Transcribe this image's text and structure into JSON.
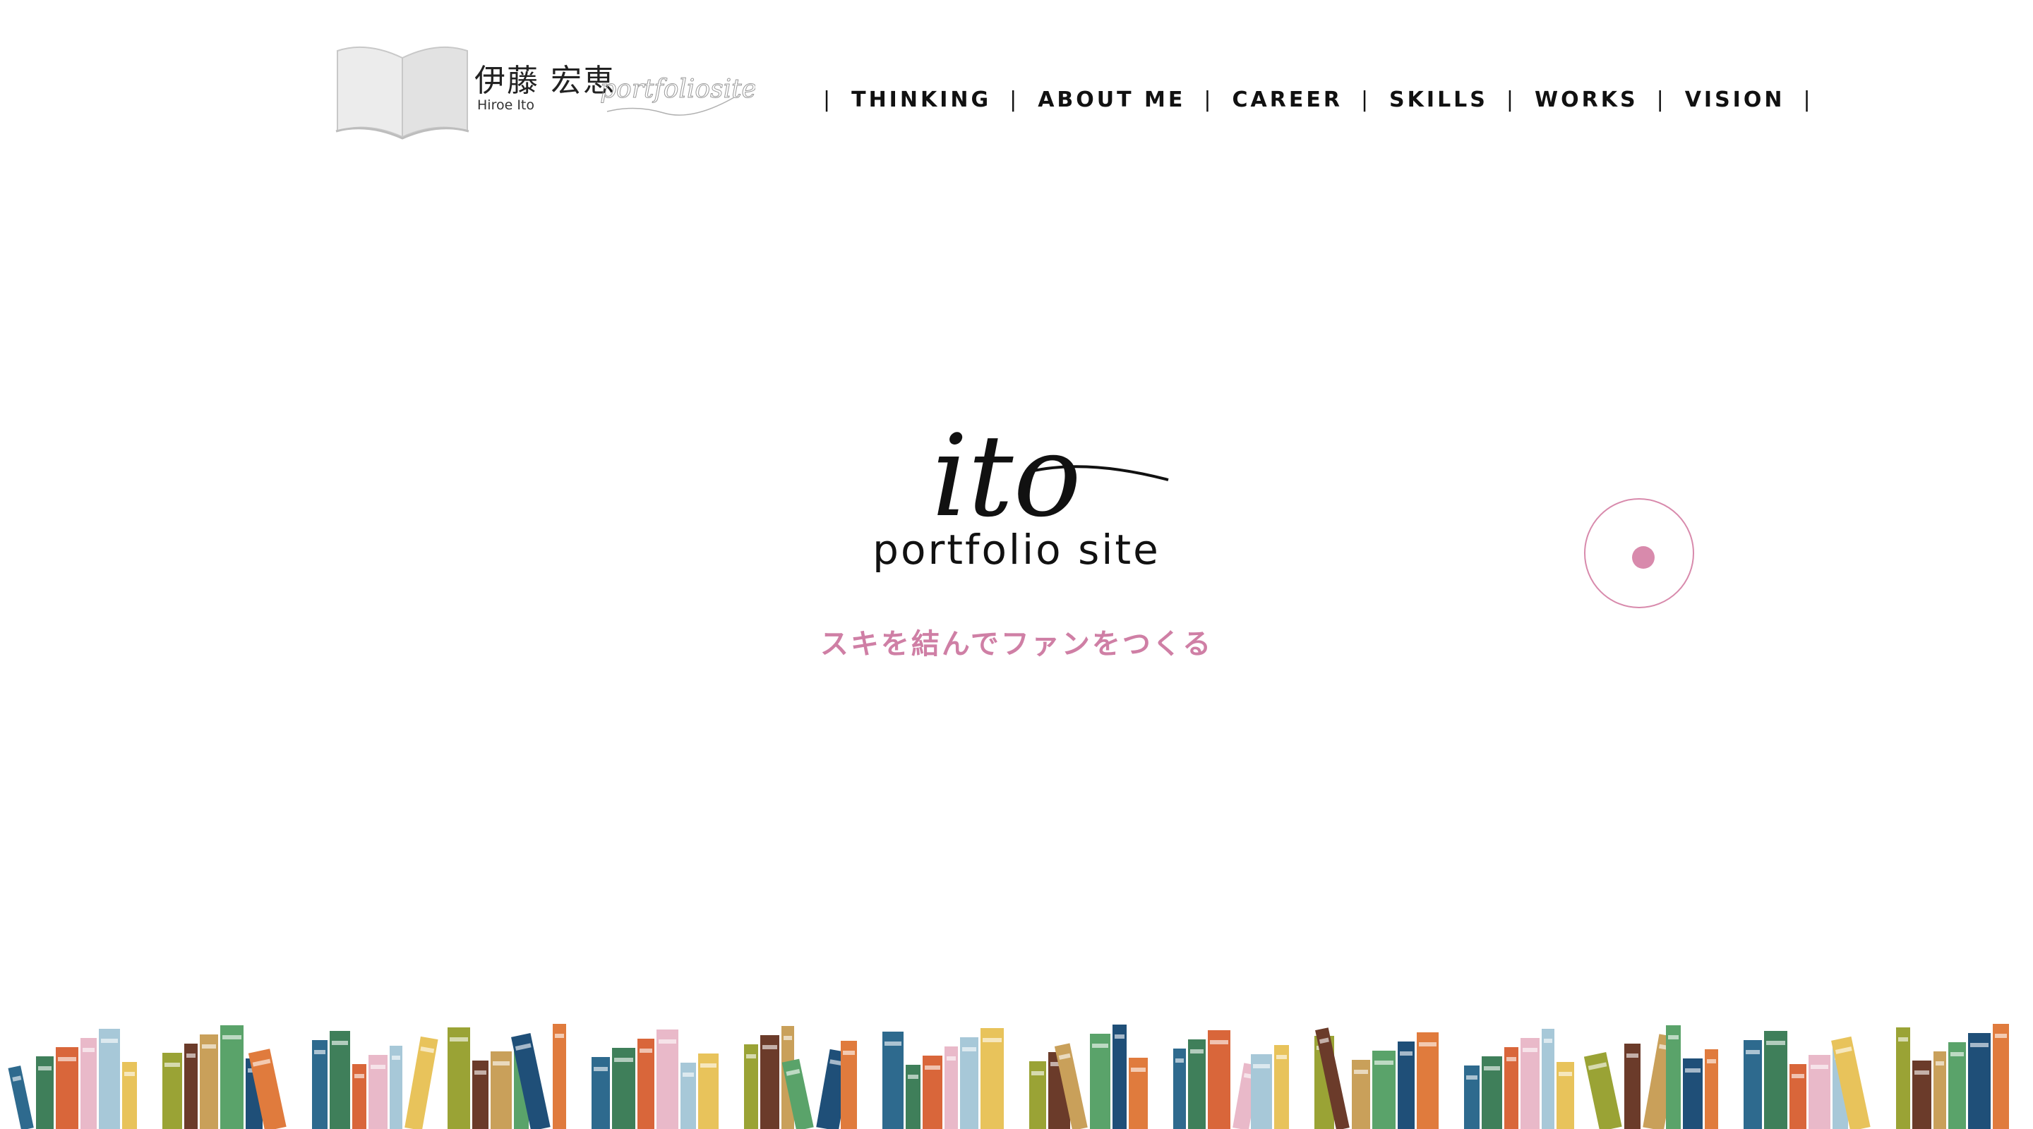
{
  "header": {
    "logo": {
      "name_jp": "伊藤 宏恵",
      "name_en": "Hiroe Ito",
      "script": "portfoliosite"
    },
    "nav": {
      "separator": "|",
      "items": [
        {
          "label": "THINKING"
        },
        {
          "label": "ABOUT ME"
        },
        {
          "label": "CAREER"
        },
        {
          "label": "SKILLS"
        },
        {
          "label": "WORKS"
        },
        {
          "label": "VISION"
        }
      ]
    }
  },
  "hero": {
    "script_title": "ito",
    "subtitle": "portfolio site",
    "tagline": "スキを結んでファンをつくる"
  },
  "colors": {
    "accent": "#cf7fa5",
    "text": "#111111",
    "book_palette": [
      "#2e6a8e",
      "#3f7f5a",
      "#d9663a",
      "#e9b9c9",
      "#a7c8d8",
      "#e8c35b",
      "#9aa335",
      "#6b3b2a",
      "#c9a05a",
      "#5aa36a",
      "#1f4f78",
      "#e07b3d"
    ]
  },
  "icons": {
    "logo_book": "open-book-icon",
    "scroll": "scroll-circle-icon"
  }
}
